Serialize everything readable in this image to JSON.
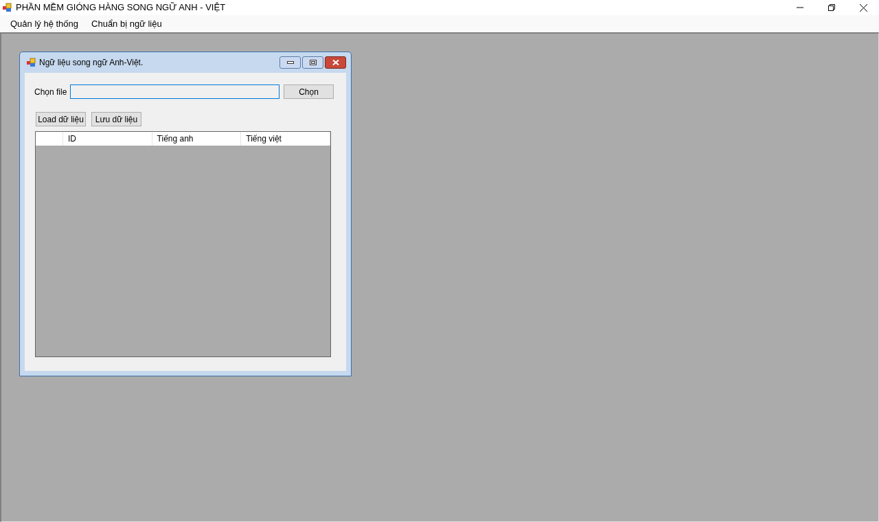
{
  "window": {
    "title": "PHẦN MỀM GIÓNG HÀNG SONG NGỮ ANH - VIỆT"
  },
  "menu": [
    "Quản lý hệ thống",
    "Chuẩn bị ngữ liệu"
  ],
  "child_window": {
    "title": "Ngữ liệu song ngữ Anh-Việt.",
    "file_label": "Chọn file",
    "file_field": {
      "focused": true
    },
    "browse_button": "Chọn",
    "buttons": [
      "Load dữ liệu",
      "Lưu dữ liệu"
    ],
    "table": {
      "columns": [
        "ID",
        "Tiếng anh",
        "Tiếng việt"
      ]
    }
  }
}
